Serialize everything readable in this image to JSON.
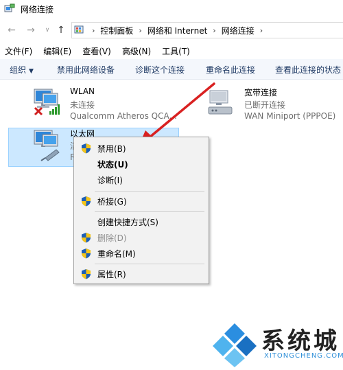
{
  "window": {
    "title": "网络连接"
  },
  "address": {
    "crumbs": [
      "控制面板",
      "网络和 Internet",
      "网络连接"
    ]
  },
  "menubar": [
    "文件(F)",
    "编辑(E)",
    "查看(V)",
    "高级(N)",
    "工具(T)"
  ],
  "commands": {
    "organize": "组织",
    "disable": "禁用此网络设备",
    "diagnose": "诊断这个连接",
    "rename": "重命名此连接",
    "view_status": "查看此连接的状态"
  },
  "adapters": {
    "wlan": {
      "name": "WLAN",
      "status": "未连接",
      "device": "Qualcomm Atheros QCA..."
    },
    "broadband": {
      "name": "宽带连接",
      "status": "已断开连接",
      "device": "WAN Miniport (PPPOE)"
    },
    "ethernet": {
      "name": "以太网",
      "status": "湍",
      "device": "R"
    }
  },
  "context_menu": {
    "disable": "禁用(B)",
    "status": "状态(U)",
    "diagnose": "诊断(I)",
    "bridge": "桥接(G)",
    "shortcut": "创建快捷方式(S)",
    "delete": "删除(D)",
    "rename": "重命名(M)",
    "properties": "属性(R)"
  },
  "watermark": {
    "text": "系统城",
    "sub": "XITONGCHENG.COM"
  },
  "colors": {
    "accent_red": "#d92121",
    "selection": "#cce8ff",
    "shield_blue": "#1d5fb6",
    "shield_yellow": "#f5c518"
  }
}
